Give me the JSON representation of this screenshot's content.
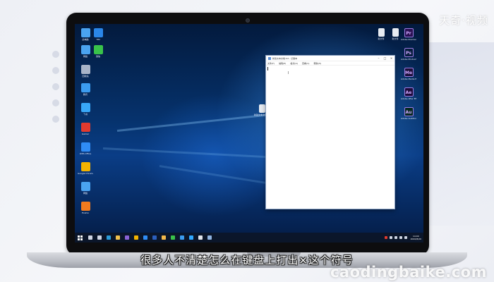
{
  "watermark": {
    "top": "天奇·视频",
    "bottom": "caodingbaike.com"
  },
  "subtitle": "很多人不清楚怎么在键盘上打出×这个符号",
  "desktop": {
    "left_icons": [
      {
        "label": "此电脑",
        "icon": "computer-icon",
        "color": "#4aa3f0"
      },
      {
        "label": "TIM",
        "icon": "tim-icon",
        "color": "#2a86e8"
      },
      {
        "label": "网络",
        "icon": "network-icon",
        "color": "#4aa3f0"
      },
      {
        "label": "微信",
        "icon": "wechat-icon",
        "color": "#39c24a"
      },
      {
        "label": "回收站",
        "icon": "recycle-bin-icon",
        "color": "#a8b4c8"
      },
      {
        "label": "腾讯",
        "icon": "tencent-icon",
        "color": "#3b9cf0"
      },
      {
        "label": "飞书",
        "icon": "feishu-icon",
        "color": "#38a8f8"
      },
      {
        "label": "Gamer",
        "icon": "game-icon",
        "color": "#e23a2e"
      },
      {
        "label": "WPS Office",
        "icon": "wps-icon",
        "color": "#2f8cf5"
      },
      {
        "label": "Google Chrome",
        "icon": "chrome-icon",
        "color": "#f2b300"
      },
      {
        "label": "网络",
        "icon": "globe-icon",
        "color": "#4aa3f0"
      },
      {
        "label": "Firefox",
        "icon": "firefox-icon",
        "color": "#f07a1e"
      }
    ],
    "center_icon": {
      "label": "新建文本文档.txt",
      "icon": "text-file-icon",
      "color": "#e8ecf2"
    },
    "right_icons": [
      {
        "label": "新文件",
        "icon": "file-icon",
        "color": "#e8ecf2"
      },
      {
        "label": "新文件",
        "icon": "file-icon",
        "color": "#e8ecf2"
      },
      {
        "label": "Adobe Premiere Pro",
        "icon": "premiere-icon",
        "color": "#2a1052",
        "text": "Pr"
      },
      {
        "label": "Adobe Photoshop",
        "icon": "photoshop-icon",
        "color": "#071d3d",
        "text": "Ps"
      },
      {
        "label": "Adobe Media Encoder",
        "icon": "media-encoder-icon",
        "color": "#1d0f3a",
        "text": "Me"
      },
      {
        "label": "Adobe After Effects",
        "icon": "after-effects-icon",
        "color": "#1d0a3a",
        "text": "Ae"
      },
      {
        "label": "Adobe Audition",
        "icon": "audition-icon",
        "color": "#05291f",
        "text": "Au"
      }
    ]
  },
  "notepad": {
    "title": "新建文本文档.txt - 记事本",
    "menus": [
      "文件(F)",
      "编辑(E)",
      "格式(O)",
      "查看(V)",
      "帮助(H)"
    ],
    "caret_line": "",
    "cursor_glyph": "I"
  },
  "taskbar": {
    "apps": [
      {
        "icon": "search-icon",
        "color": "#cfd6e4"
      },
      {
        "icon": "task-view-icon",
        "color": "#cfd6e4"
      },
      {
        "icon": "edge-icon",
        "color": "#2a9bd8"
      },
      {
        "icon": "explorer-icon",
        "color": "#f2c14e"
      },
      {
        "icon": "premiere-icon",
        "color": "#8a62d6"
      },
      {
        "icon": "chrome-icon",
        "color": "#f2b300"
      },
      {
        "icon": "mail-icon",
        "color": "#2f8cf5"
      },
      {
        "icon": "word-icon",
        "color": "#2b5fbd"
      },
      {
        "icon": "folder-icon",
        "color": "#f2b84b"
      },
      {
        "icon": "wechat-icon",
        "color": "#39c24a"
      },
      {
        "icon": "qq-icon",
        "color": "#3b9cf0"
      },
      {
        "icon": "photoshop-icon",
        "color": "#31a8ff"
      },
      {
        "icon": "app-icon",
        "color": "#e0e4ec"
      },
      {
        "icon": "notepad-icon",
        "color": "#8fb3e0"
      }
    ],
    "tray": [
      {
        "icon": "input-method-icon",
        "color": "#e23a2e"
      },
      {
        "icon": "wifi-icon",
        "color": "#cfd6e4"
      },
      {
        "icon": "volume-icon",
        "color": "#cfd6e4"
      },
      {
        "icon": "battery-icon",
        "color": "#cfd6e4"
      },
      {
        "icon": "language-icon",
        "color": "#cfd6e4"
      }
    ],
    "clock_time": "14:00",
    "clock_date": "2020/8/20"
  }
}
